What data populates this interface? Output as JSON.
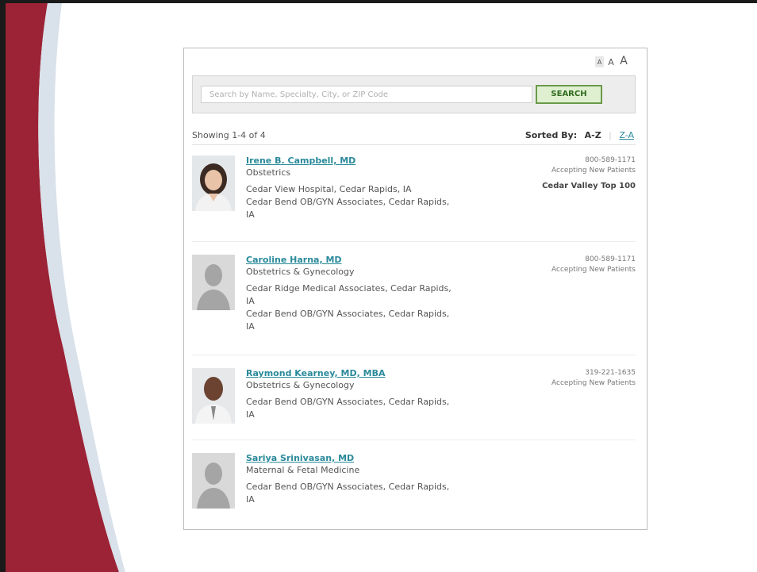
{
  "text_size": {
    "small": "A",
    "medium": "A",
    "large": "A"
  },
  "search": {
    "placeholder": "Search by Name, Specialty, City, or ZIP Code",
    "button_label": "SEARCH"
  },
  "results": {
    "showing": "Showing 1-4 of 4",
    "sort_label": "Sorted By:",
    "sort_az": "A-Z",
    "sort_za": "Z-A"
  },
  "doctors": [
    {
      "name": "Irene B. Campbell, MD",
      "specialty": "Obstetrics",
      "locations": [
        "Cedar View Hospital, Cedar Rapids, IA",
        "Cedar Bend OB/GYN Associates, Cedar Rapids, IA"
      ],
      "phone": "800-589-1171",
      "accepting": "Accepting New Patients",
      "badge": "Cedar Valley Top 100"
    },
    {
      "name": "Caroline Harna, MD",
      "specialty": "Obstetrics & Gynecology",
      "locations": [
        "Cedar Ridge Medical Associates, Cedar Rapids, IA",
        "Cedar Bend OB/GYN Associates, Cedar Rapids, IA"
      ],
      "phone": "800-589-1171",
      "accepting": "Accepting New Patients"
    },
    {
      "name": "Raymond Kearney, MD, MBA",
      "specialty": "Obstetrics & Gynecology",
      "locations": [
        "Cedar Bend OB/GYN Associates, Cedar Rapids, IA"
      ],
      "phone": "319-221-1635",
      "accepting": "Accepting New Patients"
    },
    {
      "name": "Sariya Srinivasan, MD",
      "specialty": "Maternal & Fetal Medicine",
      "locations": [
        "Cedar Bend OB/GYN Associates, Cedar Rapids, IA"
      ]
    }
  ],
  "colors": {
    "accent_red": "#9b2335",
    "link_teal": "#2a8a9a",
    "button_green": "#6a9a4a"
  }
}
